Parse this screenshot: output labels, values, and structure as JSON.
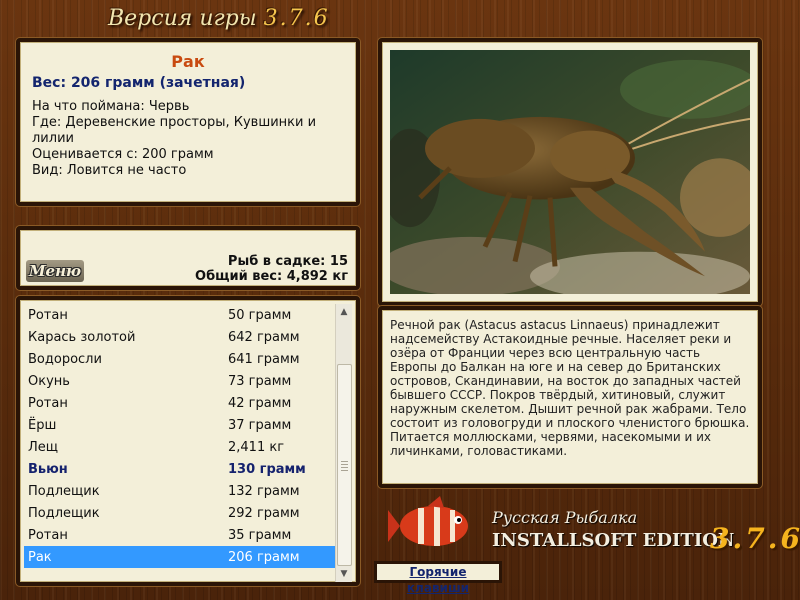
{
  "header": {
    "version_prefix": "Версия игры",
    "version_number": "3.7.6"
  },
  "info": {
    "fish_name": "Рак",
    "weight_line": "Вес: 206 грамм (зачетная)",
    "lines": [
      "На что поймана: Червь",
      "Где: Деревенские просторы, Кувшинки и",
      "лилии",
      "Оценивается с: 200 грамм",
      "Вид: Ловится не часто"
    ]
  },
  "stats": {
    "menu_label": "Меню",
    "fish_in_net": "Рыб в садке: 15",
    "total_weight": "Общий вес: 4,892 кг"
  },
  "catch_list": [
    {
      "name": "Ротан",
      "weight": "50 грамм",
      "style": ""
    },
    {
      "name": "Карась золотой",
      "weight": "642 грамм",
      "style": ""
    },
    {
      "name": "Водоросли",
      "weight": "641 грамм",
      "style": ""
    },
    {
      "name": "Окунь",
      "weight": "73 грамм",
      "style": ""
    },
    {
      "name": "Ротан",
      "weight": "42 грамм",
      "style": ""
    },
    {
      "name": "Ёрш",
      "weight": "37 грамм",
      "style": ""
    },
    {
      "name": "Лещ",
      "weight": "2,411 кг",
      "style": ""
    },
    {
      "name": "Вьюн",
      "weight": "130 грамм",
      "style": "bold"
    },
    {
      "name": "Подлещик",
      "weight": "132 грамм",
      "style": ""
    },
    {
      "name": "Подлещик",
      "weight": "292 грамм",
      "style": ""
    },
    {
      "name": "Ротан",
      "weight": "35 грамм",
      "style": ""
    },
    {
      "name": "Рак",
      "weight": "206 грамм",
      "style": "sel"
    }
  ],
  "scrollbar": {
    "up_glyph": "▲",
    "down_glyph": "▼"
  },
  "description": "Речной рак (Astacus astacus Linnaeus) принадлежит надсемейству Астакоидные речные. Населяет реки и озёра от Франции через всю центральную часть Европы до Балкан на юге и на север до Британских островов, Скандинавии, на восток до западных частей бывшего СССР. Покров твёрдый, хитиновый, служит наружным скелетом. Дышит речной рак жабрами. Тело состоит из головогруди и плоского членистого брюшка. Питается моллюсками, червями, насекомыми и их личинками, головастиками.",
  "logo": {
    "line1": "Русская Рыбалка",
    "line2": "INSTALLSOFT EDITION",
    "version": "3.7.6"
  },
  "hotkeys_label": "Горячие клавиши",
  "colors": {
    "accent_title": "#c84a10",
    "weight_text": "#13256e",
    "selection": "#3399ff",
    "panel_bg": "#f3efd9",
    "wood": "#5a2c0c"
  }
}
